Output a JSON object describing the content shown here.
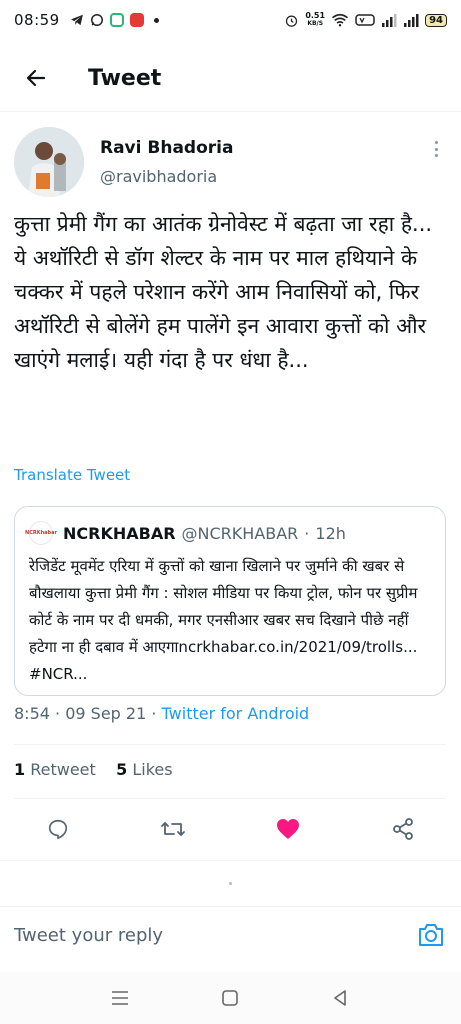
{
  "status_bar": {
    "time": "08:59",
    "net_speed_value": "0.51",
    "net_speed_unit": "KB/S",
    "battery": "94",
    "icons": [
      "telegram-icon",
      "whatsapp-icon",
      "app-icon",
      "sos-icon",
      "dot-icon",
      "alarm-icon",
      "wifi-icon",
      "volte-icon",
      "signal-icon",
      "signal-icon",
      "battery-icon"
    ]
  },
  "header": {
    "title": "Tweet"
  },
  "author": {
    "name": "Ravi Bhadoria",
    "handle": "@ravibhadoria"
  },
  "tweet": {
    "text": "कुत्ता प्रेमी गैंग का आतंक ग्रेनोवेस्ट में बढ़ता जा रहा है... ये अथॉरिटी से डॉग शेल्टर के नाम पर माल हथियाने के चक्कर में पहले परेशान करेंगे आम निवासियों को, फिर अथॉरिटी से बोलेंगे हम पालेंगे इन आवारा कुत्तों को और खाएंगे मलाई। यही गंदा है पर धंधा है...",
    "translate_label": "Translate Tweet"
  },
  "quote": {
    "name": "NCRKHABAR",
    "handle": "@NCRKHABAR",
    "separator": "·",
    "time": "12h",
    "avatar_text": "NCRKhabar",
    "text": "रेजिडेंट मूवमेंट एरिया में कुत्तों को खाना खिलाने पर जुर्माने की खबर से बौखलाया कुत्ता प्रेमी गैंग : सोशल मीडिया पर किया ट्रोल, फोन पर सुप्रीम कोर्ट के नाम पर दी धमकी, मगर एनसीआर खबर सच दिखाने पीछे नहीं हटेगा ना ही दबाव में आएगाncrkhabar.co.in/2021/09/trolls... #NCR..."
  },
  "meta": {
    "time": "8:54",
    "separator": "·",
    "date": "09 Sep 21",
    "source": "Twitter for Android"
  },
  "stats": {
    "retweets_count": "1",
    "retweets_label": "Retweet",
    "likes_count": "5",
    "likes_label": "Likes"
  },
  "reply": {
    "placeholder": "Tweet your reply"
  },
  "colors": {
    "accent": "#1d9bf0",
    "like": "#f91880",
    "text": "#0f1419",
    "muted": "#536471"
  }
}
